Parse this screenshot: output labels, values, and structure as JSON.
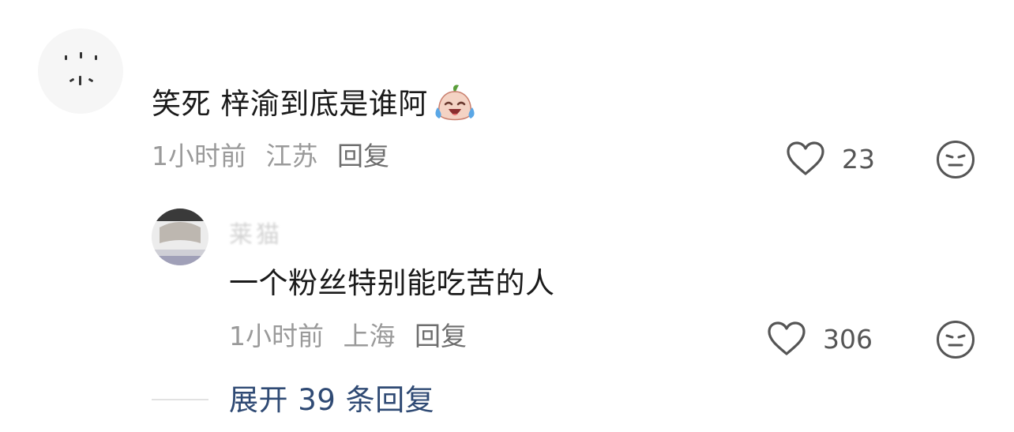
{
  "comment": {
    "text": "笑死 梓渝到底是谁阿",
    "emoji": "laughing-crying-emoji",
    "time": "1小时前",
    "location": "江苏",
    "reply_label": "回复",
    "likes": "23"
  },
  "reply": {
    "author": "莱猫",
    "text": "一个粉丝特别能吃苦的人",
    "time": "1小时前",
    "location": "上海",
    "reply_label": "回复",
    "likes": "306"
  },
  "expand_label": "展开 39 条回复",
  "icons": {
    "like": "heart-icon",
    "react": "neutral-face-icon"
  },
  "colors": {
    "text": "#1a1a1a",
    "meta": "#9a9a9a",
    "link": "#2f4a74",
    "icon": "#555555"
  }
}
